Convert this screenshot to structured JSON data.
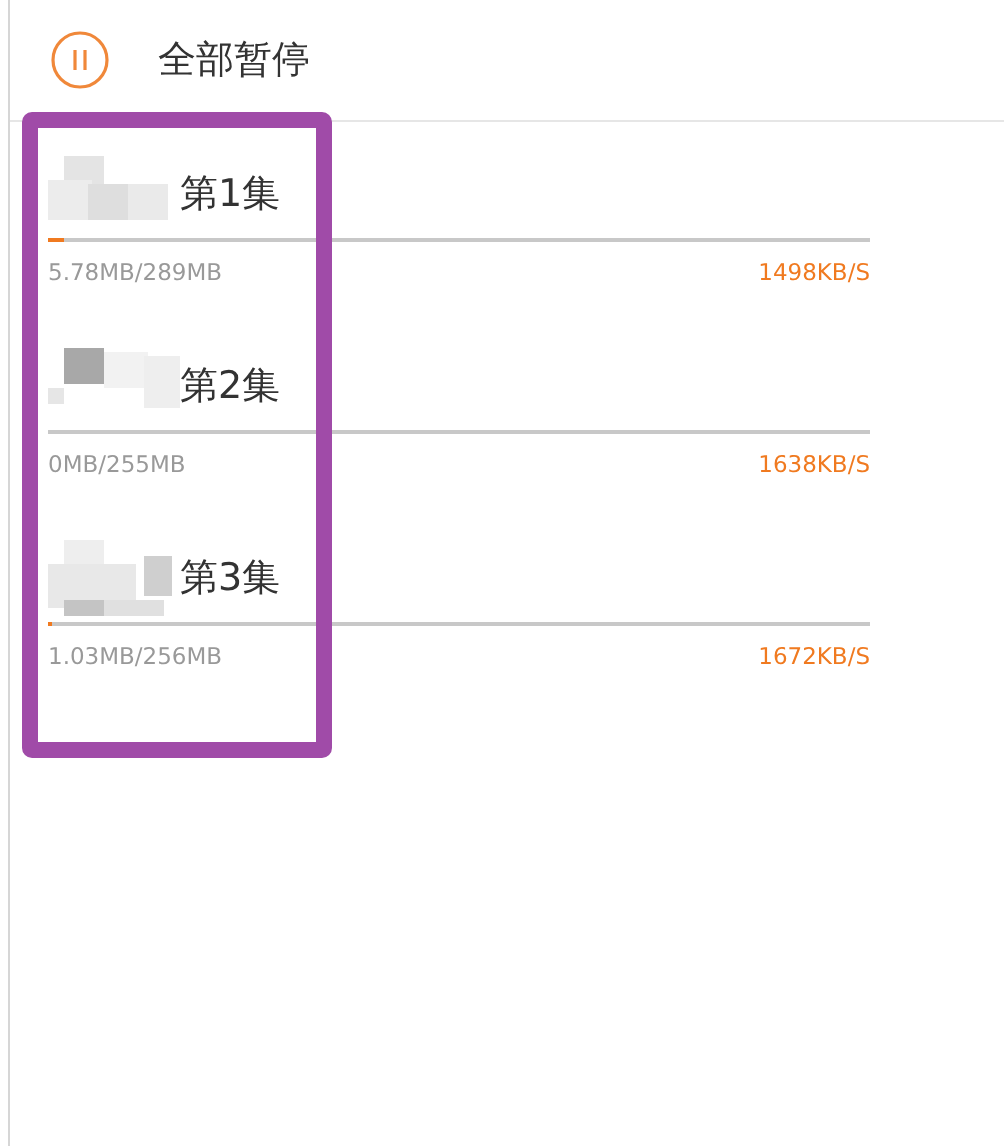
{
  "header": {
    "pause_all_label": "全部暂停"
  },
  "downloads": [
    {
      "title": "第1集",
      "size": "5.78MB/289MB",
      "speed": "1498KB/S",
      "level": 0.02
    },
    {
      "title": "第2集",
      "size": "0MB/255MB",
      "speed": "1638KB/S",
      "level": 0
    },
    {
      "title": "第3集",
      "size": "1.03MB/256MB",
      "speed": "1672KB/S",
      "level": 0.004
    }
  ]
}
